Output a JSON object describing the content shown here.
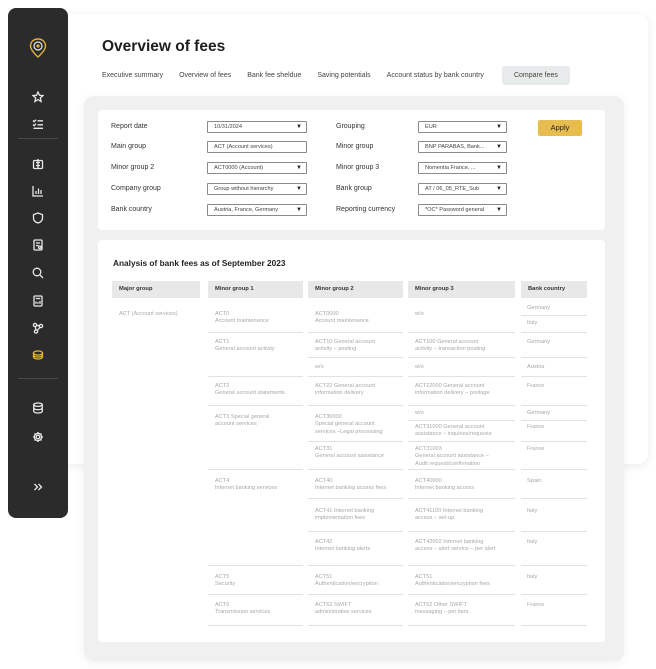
{
  "page": {
    "title": "Overview of fees",
    "tabs": [
      "Executive summary",
      "Overview of fees",
      "Bank fee sheldue",
      "Saving potentials",
      "Account status by bank country",
      "Compare fees"
    ]
  },
  "sidebar": {
    "icons": [
      "star-icon",
      "checklist-icon",
      "wallet-icon",
      "bar-chart-icon",
      "shield-icon",
      "document-icon",
      "search-icon",
      "calculator-icon",
      "network-icon",
      "coins-icon",
      "database-icon",
      "settings-icon",
      "expand-icon"
    ],
    "active": "coins-icon",
    "accent": "#e2b43a"
  },
  "filters": {
    "report_date_label": "Report date",
    "report_date": "10/31/2024",
    "grouping_label": "Grouping",
    "grouping": "EUR",
    "main_group_label": "Main group",
    "main_group": "ACT (Account services)",
    "minor_group_label": "Minor group",
    "minor_group": "BNP PARABAS, Bank...",
    "minor_group2_label": "Minor group 2",
    "minor_group2": "ACT0000 (Account)",
    "minor_group3_label": "Minor group 3",
    "minor_group3": "Nomentia France, ...",
    "company_group_label": "Company group",
    "company_group": "Group without hierarchy",
    "bank_group_label": "Bank group",
    "bank_group": "AT / 06_05_RTE_Sub",
    "bank_country_label": "Bank country",
    "bank_country": "Austria, France, Germany",
    "reporting_currency_label": "Reporting currency",
    "reporting_currency": "*OC* Password general",
    "apply_label": "Apply",
    "apply_color": "#e8bd4f",
    "arrow": "▼"
  },
  "analysis": {
    "title": "Analysis of bank fees as of September 2023",
    "headers": [
      "Major group",
      "Minor group 1",
      "Minor group 2",
      "Minor group 3",
      "Bank country"
    ],
    "major": "ACT (Account services)",
    "minor1": [
      [
        "ACT0",
        "Account maintenance"
      ],
      [
        "ACT1",
        "General account activity"
      ],
      [
        "ACT2",
        "General account statements"
      ],
      [
        "ACT3 Special general",
        "account services"
      ],
      [
        "ACT4",
        "Internet banking services"
      ],
      [
        "ACT5",
        "Security"
      ],
      [
        "ACT6",
        "Transmission services"
      ]
    ],
    "minor2": [
      [
        "ACT0000",
        "Account maintenance"
      ],
      [
        "ACT10 General account",
        "activity – posting"
      ],
      [
        "w/o"
      ],
      [
        "ACT22 General account",
        "information delivery"
      ],
      [
        "ACT30000",
        "Special general account",
        "services –Legal processing"
      ],
      [
        "ACT31",
        "General account assistance"
      ],
      [
        "ACT40",
        "Internet banking access fees"
      ],
      [
        "ACT41 Internet banking",
        "implementation fees"
      ],
      [
        "ACT42",
        "Internet banking alerts"
      ],
      [
        "ACT51",
        "Authentication/encryption"
      ],
      [
        "ACT62 SWIFT",
        "administrative services"
      ]
    ],
    "minor3": [
      [
        "w/o"
      ],
      [
        "ACT100 General account",
        "activity – transaction posting"
      ],
      [
        "w/o"
      ],
      [
        "ACT22000 General account",
        "information delivery – postage"
      ],
      [
        "w/o"
      ],
      [
        "ACT31000 General account",
        "assistance – inquiries/requests"
      ],
      [
        "ACT31003",
        "General account assistance –",
        "Audit request/confirmation"
      ],
      [
        "ACT40000",
        "Internet banking access"
      ],
      [
        "ACT41100 Internet banking",
        "access – set-up"
      ],
      [
        "ACT42002 Internet banking",
        "access – alert service – per alert"
      ],
      [
        "ACT51",
        "Authentication/encryption fees"
      ],
      [
        "ACT62 Other SWIFT",
        "messaging – per item"
      ]
    ],
    "country": [
      "Germany",
      "Italy",
      "Germany",
      "Austria",
      "France",
      "Germany",
      "France",
      "France",
      "Spain",
      "Italy",
      "Italy",
      "Italy",
      "France"
    ]
  }
}
